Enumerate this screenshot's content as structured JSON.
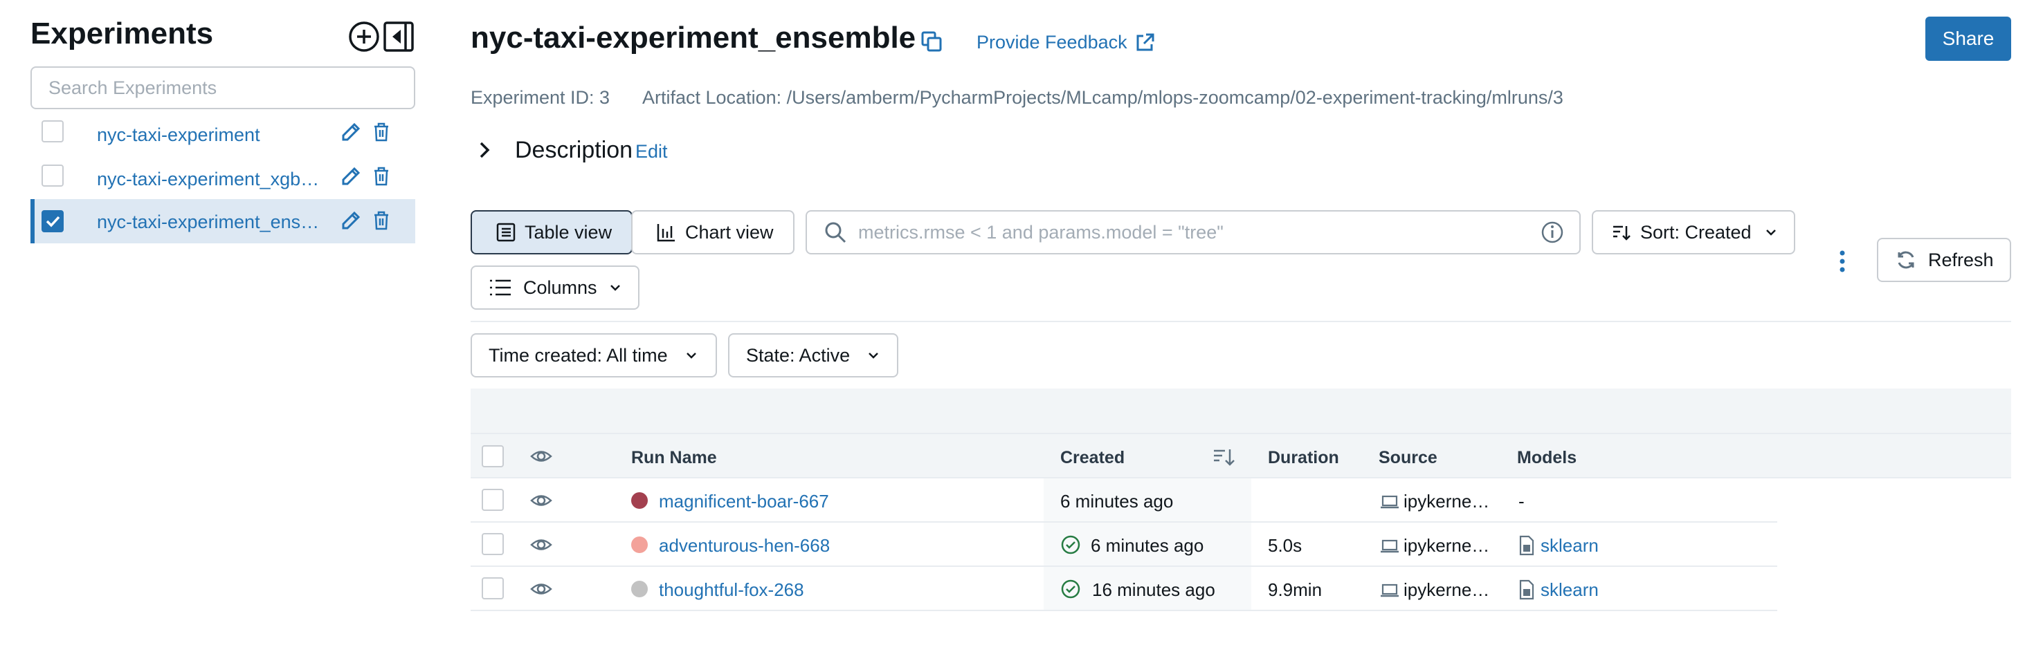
{
  "sidebar": {
    "title": "Experiments",
    "search_placeholder": "Search Experiments",
    "items": [
      {
        "label": "nyc-taxi-experiment",
        "checked": false
      },
      {
        "label": "nyc-taxi-experiment_xgb…",
        "checked": false
      },
      {
        "label": "nyc-taxi-experiment_ens…",
        "checked": true
      }
    ]
  },
  "header": {
    "title": "nyc-taxi-experiment_ensemble",
    "feedback_label": "Provide Feedback",
    "share_label": "Share",
    "experiment_id": "Experiment ID: 3",
    "artifact_location": "Artifact Location: /Users/amberm/PycharmProjects/MLcamp/mlops-zoomcamp/02-experiment-tracking/mlruns/3",
    "description_label": "Description",
    "edit_label": "Edit"
  },
  "toolbar": {
    "table_view": "Table view",
    "chart_view": "Chart view",
    "search_placeholder": "metrics.rmse < 1 and params.model = \"tree\"",
    "sort_label": "Sort: Created",
    "refresh_label": "Refresh",
    "columns_label": "Columns",
    "time_filter": "Time created: All time",
    "state_filter": "State: Active"
  },
  "table": {
    "headers": {
      "run_name": "Run Name",
      "created": "Created",
      "duration": "Duration",
      "source": "Source",
      "models": "Models"
    },
    "rows": [
      {
        "color": "#a3404f",
        "name": "magnificent-boar-667",
        "status": "none",
        "created": "6 minutes ago",
        "duration": "",
        "source": "ipykerne…",
        "model": "-",
        "model_is_link": false
      },
      {
        "color": "#f3a29a",
        "name": "adventurous-hen-668",
        "status": "finished",
        "created": "6 minutes ago",
        "duration": "5.0s",
        "source": "ipykerne…",
        "model": "sklearn",
        "model_is_link": true
      },
      {
        "color": "#c2c2c2",
        "name": "thoughtful-fox-268",
        "status": "finished",
        "created": "16 minutes ago",
        "duration": "9.9min",
        "source": "ipykerne…",
        "model": "sklearn",
        "model_is_link": true
      }
    ]
  },
  "colors": {
    "accent": "#2272b4",
    "selected_bg": "#dde8f3",
    "success": "#277c43",
    "border": "#c9cdd2"
  }
}
